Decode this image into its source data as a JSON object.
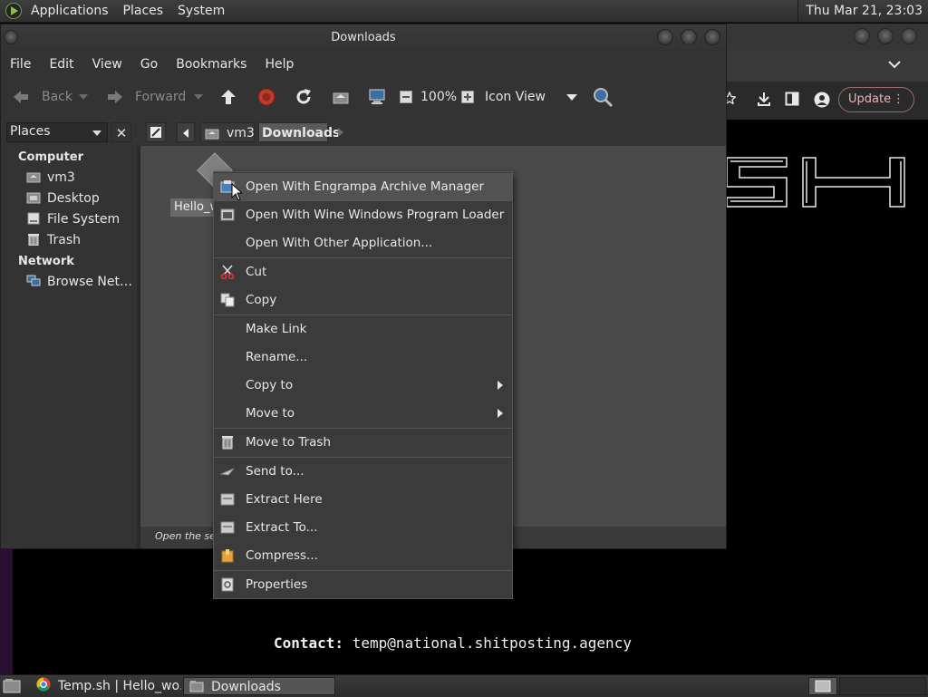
{
  "top_panel": {
    "menus": [
      "Applications",
      "Places",
      "System"
    ],
    "clock": "Thu Mar 21, 23:03"
  },
  "browser": {
    "update_label": "Update",
    "icons": [
      "chevron-down-icon",
      "bookmark-star-icon",
      "download-icon",
      "sidebar-icon",
      "profile-icon",
      "more-icon"
    ],
    "contact_label": "Contact:",
    "contact_email": "temp@national.shitposting.agency"
  },
  "file_manager": {
    "title": "Downloads",
    "menu": [
      "File",
      "Edit",
      "View",
      "Go",
      "Bookmarks",
      "Help"
    ],
    "toolbar": {
      "back_label": "Back",
      "forward_label": "Forward",
      "zoom_level": "100%",
      "view_mode": "Icon View"
    },
    "sidebar": {
      "selector_label": "Places",
      "headings": {
        "computer": "Computer",
        "network": "Network"
      },
      "items": [
        "vm3",
        "Desktop",
        "File System",
        "Trash",
        "Browse Net…"
      ]
    },
    "path": [
      "vm3",
      "Downloads"
    ],
    "file": {
      "label": "Hello_w"
    },
    "status": "Open the sele"
  },
  "context_menu": {
    "items": [
      {
        "label": "Open With Engrampa Archive Manager",
        "icon": "archive-manager-icon"
      },
      {
        "label": "Open With Wine Windows Program Loader",
        "icon": "wine-icon"
      },
      {
        "label": "Open With Other Application...",
        "icon": ""
      },
      {
        "label": "Cut",
        "icon": "scissors-icon"
      },
      {
        "label": "Copy",
        "icon": "copy-icon"
      },
      {
        "label": "Make Link",
        "icon": ""
      },
      {
        "label": "Rename...",
        "icon": ""
      },
      {
        "label": "Copy to",
        "icon": ""
      },
      {
        "label": "Move to",
        "icon": ""
      },
      {
        "label": "Move to Trash",
        "icon": "trash-icon"
      },
      {
        "label": "Send to...",
        "icon": "send-icon"
      },
      {
        "label": "Extract Here",
        "icon": "extract-icon"
      },
      {
        "label": "Extract To...",
        "icon": "extract-icon"
      },
      {
        "label": "Compress...",
        "icon": "compress-icon"
      },
      {
        "label": "Properties",
        "icon": "properties-icon"
      }
    ]
  },
  "taskbar": {
    "tasks": [
      "Temp.sh | Hello_wo…",
      "Downloads"
    ]
  }
}
